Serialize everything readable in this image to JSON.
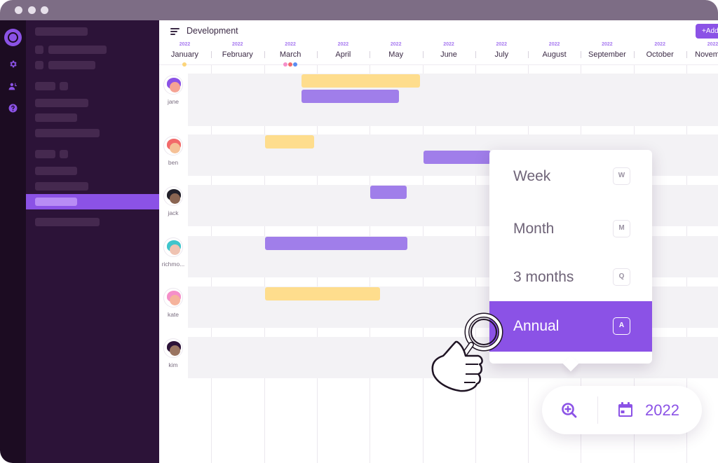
{
  "window": {
    "traffic_lights": [
      "close",
      "minimize",
      "maximize"
    ]
  },
  "icon_rail": {
    "items": [
      {
        "name": "app-logo-icon"
      },
      {
        "name": "gear-icon"
      },
      {
        "name": "users-icon"
      },
      {
        "name": "help-icon"
      }
    ]
  },
  "header": {
    "title": "Development",
    "add_button": "+Add"
  },
  "timeline": {
    "months": [
      {
        "year": "2022",
        "name": "January"
      },
      {
        "year": "2022",
        "name": "February"
      },
      {
        "year": "2022",
        "name": "March"
      },
      {
        "year": "2022",
        "name": "April"
      },
      {
        "year": "2022",
        "name": "May"
      },
      {
        "year": "2022",
        "name": "June"
      },
      {
        "year": "2022",
        "name": "July"
      },
      {
        "year": "2022",
        "name": "August"
      },
      {
        "year": "2022",
        "name": "September"
      },
      {
        "year": "2022",
        "name": "October"
      },
      {
        "year": "2022",
        "name": "November"
      }
    ],
    "event_markers": [
      {
        "month": "January",
        "color": "#fcd57a"
      },
      {
        "month": "March",
        "color": "#f58fc9"
      },
      {
        "month": "March",
        "color": "#f26a6a"
      },
      {
        "month": "March",
        "color": "#5b8cf0"
      }
    ],
    "users": [
      {
        "name": "jane",
        "hair": "#8b52e6",
        "skin": "#f5a394"
      },
      {
        "name": "ben",
        "hair": "#f26a6a",
        "skin": "#f5c197"
      },
      {
        "name": "jack",
        "hair": "#22202a",
        "skin": "#8a6552"
      },
      {
        "name": "richmo...",
        "hair": "#3fc5cc",
        "skin": "#efc3b2"
      },
      {
        "name": "kate",
        "hair": "#f58fc9",
        "skin": "#f5b39c"
      },
      {
        "name": "kim",
        "hair": "#2c1338",
        "skin": "#9a7561"
      }
    ],
    "bars": [
      {
        "user": "jane",
        "color": "yellow",
        "start_month": 2.7,
        "end_month": 4.95
      },
      {
        "user": "jane",
        "color": "purple",
        "start_month": 2.7,
        "end_month": 4.55
      },
      {
        "user": "ben",
        "color": "yellow",
        "start_month": 2.0,
        "end_month": 2.95
      },
      {
        "user": "ben",
        "color": "purple",
        "start_month": 5.0,
        "end_month": 6.3
      },
      {
        "user": "jack",
        "color": "purple",
        "start_month": 4.0,
        "end_month": 4.7
      },
      {
        "user": "richmo...",
        "color": "purple",
        "start_month": 2.0,
        "end_month": 4.72
      },
      {
        "user": "kate",
        "color": "yellow",
        "start_month": 2.0,
        "end_month": 4.2
      }
    ]
  },
  "zoom_menu": {
    "items": [
      {
        "label": "Week",
        "shortcut": "W",
        "selected": false
      },
      {
        "label": "Month",
        "shortcut": "M",
        "selected": false
      },
      {
        "label": "3 months",
        "shortcut": "Q",
        "selected": false
      },
      {
        "label": "Annual",
        "shortcut": "A",
        "selected": true
      }
    ]
  },
  "toolbar": {
    "zoom_icon": "zoom-in-icon",
    "calendar_icon": "calendar-icon",
    "year": "2022"
  },
  "colors": {
    "accent": "#8b52e6",
    "bar_yellow": "#fedd8d",
    "bar_purple": "#a07eea",
    "sidebar_bg": "#2c1338",
    "rail_bg": "#1c0c22"
  }
}
